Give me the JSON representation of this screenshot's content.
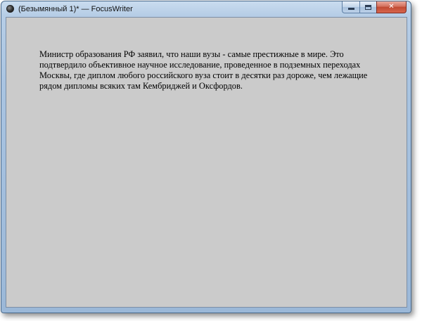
{
  "window": {
    "title": "(Безымянный 1)* — FocusWriter",
    "app_icon": "focuswriter-app-icon",
    "controls": {
      "minimize_icon": "minimize-icon",
      "maximize_icon": "maximize-icon",
      "close_icon": "close-icon",
      "close_glyph": "✕"
    }
  },
  "document": {
    "text": "Министр образования РФ заявил, что наши вузы - самые престижные в мире. Это подтвердило объективное научное исследование, проведенное в подземных переходах Москвы, где диплом любого российского вуза стоит в десятки раз дороже, чем лежащие рядом дипломы всяких там Кембриджей и Оксфордов."
  },
  "colors": {
    "editor_background": "#cbcbcb",
    "frame": "#a9c4e1",
    "close_button": "#c04a33",
    "text": "#000000"
  }
}
